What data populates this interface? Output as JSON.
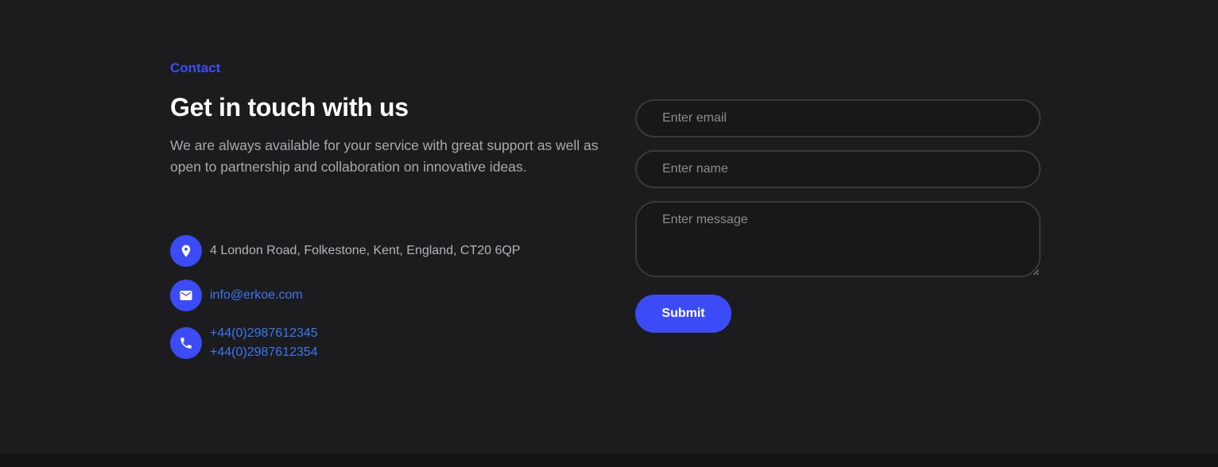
{
  "contact": {
    "eyebrow": "Contact",
    "title": "Get in touch with us",
    "description": "We are always available for your service with great support as well as open to partnership and collaboration on innovative ideas.",
    "address": "4 London Road, Folkestone, Kent, England, CT20 6QP",
    "email": "info@erkoe.com",
    "phones": [
      "+44(0)2987612345",
      "+44(0)2987612354"
    ],
    "icons": {
      "address": "location-pin-icon",
      "email": "mail-icon",
      "phone": "phone-icon"
    }
  },
  "form": {
    "email_placeholder": "Enter email",
    "name_placeholder": "Enter name",
    "message_placeholder": "Enter message",
    "submit_label": "Submit"
  },
  "colors": {
    "background": "#1c1c1f",
    "accent": "#3b4cf6",
    "link": "#3a78f5"
  }
}
